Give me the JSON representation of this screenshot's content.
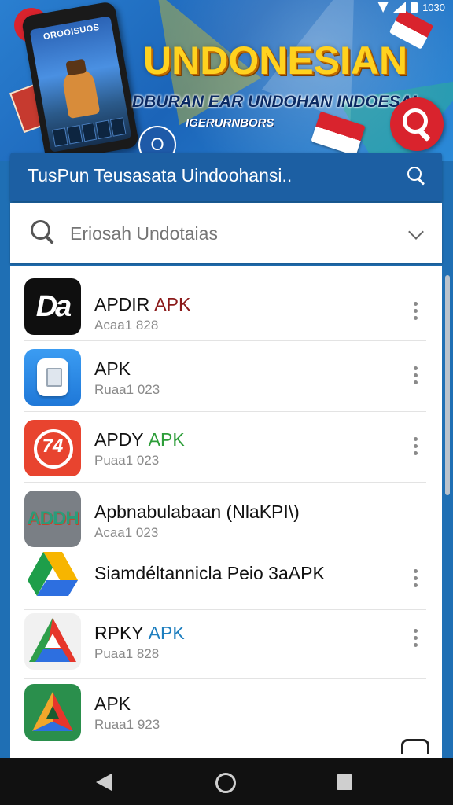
{
  "status_bar": {
    "time": "1030"
  },
  "banner": {
    "phone_title": "OROOISUOS",
    "title": "UNDONESIAN",
    "subtitle": "DBURAN EAR UNDOHAN INDOESAI",
    "subtitle2": "IGERURNBORS"
  },
  "header": {
    "title": "TusPun Teusasata Uindoohansi.."
  },
  "search": {
    "placeholder": "Eriosah Undotaias"
  },
  "list": {
    "items": [
      {
        "name": "APDIR",
        "suffix": "APK",
        "suffix_color": "#8b1a1a",
        "sub": "Acaa1 828",
        "icon": "da-logo-icon",
        "icon_text": "Da",
        "menu": true
      },
      {
        "name": "APK",
        "suffix": "",
        "suffix_color": "#111111",
        "sub": "Ruaa1 023",
        "icon": "apk-file-icon",
        "icon_text": "",
        "menu": true
      },
      {
        "name": "APDY",
        "suffix": "APK",
        "suffix_color": "#2e9e3a",
        "sub": "Puaa1 023",
        "icon": "refresh-icon",
        "icon_text": "74",
        "menu": true
      },
      {
        "name": "Apbnabulabaan (NlaKPI\\)",
        "suffix": "",
        "suffix_color": "#111111",
        "sub": "Acaa1 023",
        "icon": "archive-icon",
        "icon_text": "ADDH",
        "menu": false
      },
      {
        "name": "Siamdéltannicla Peio 3aAPK",
        "suffix": "",
        "suffix_color": "#111111",
        "sub": "",
        "icon": "google-drive-icon",
        "icon_text": "",
        "menu": true
      },
      {
        "name": "RPKY",
        "suffix": "APK",
        "suffix_color": "#1f7fbf",
        "sub": "Puaa1 828",
        "icon": "drive-triangle-icon",
        "icon_text": "",
        "menu": true
      },
      {
        "name": "APK",
        "suffix": "",
        "suffix_color": "#111111",
        "sub": "Ruaa1 923",
        "icon": "green-triangle-icon",
        "icon_text": "",
        "menu": false
      }
    ]
  },
  "colors": {
    "header": "#1c5fa3",
    "banner_title": "#ffd21f",
    "apk_red": "#8b1a1a",
    "apk_green": "#2e9e3a",
    "apk_blue": "#1f7fbf"
  }
}
